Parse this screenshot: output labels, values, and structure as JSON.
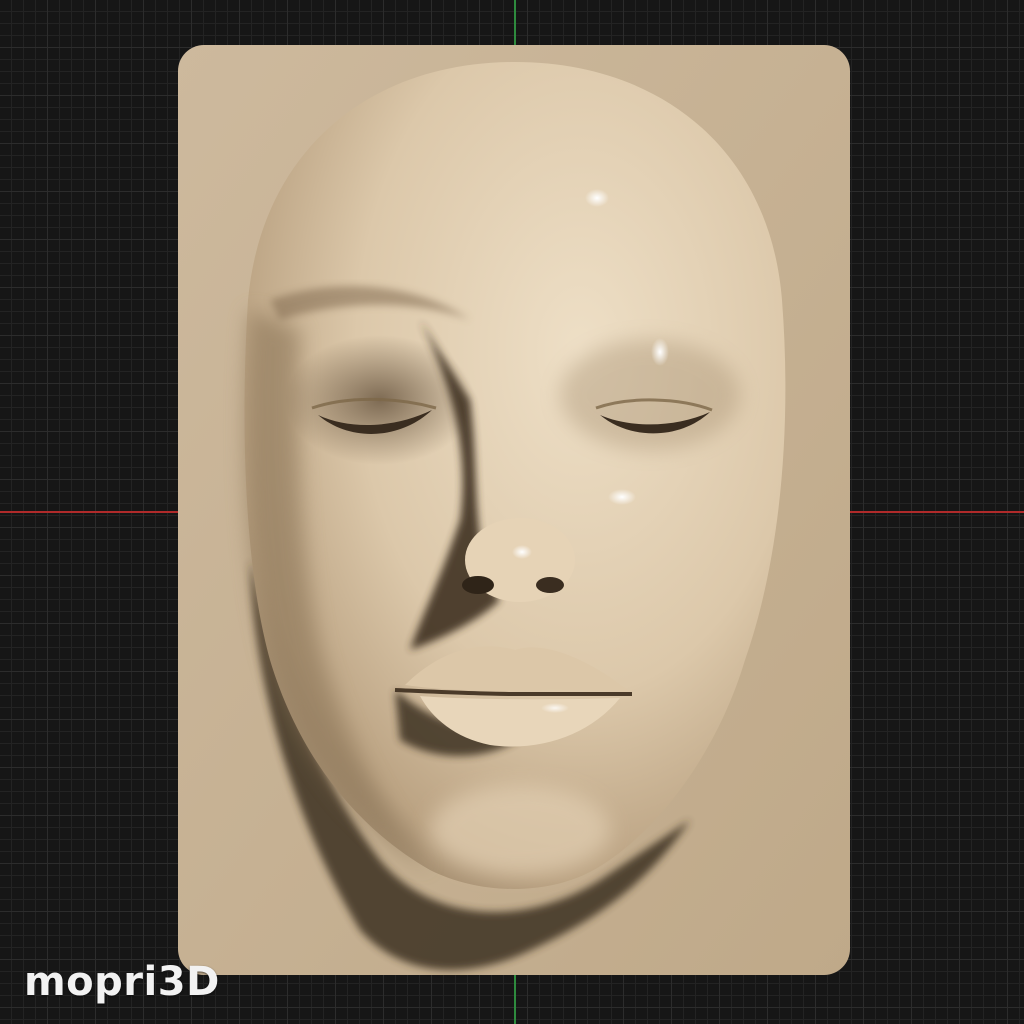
{
  "viewport": {
    "background": "#161616",
    "grid_color": "#2c2c2c",
    "axis_x_color": "#b02a2a",
    "axis_y_color": "#2e8b3e"
  },
  "model": {
    "object": "face-relief-plate",
    "material_color": "#c9b59a"
  },
  "watermark": {
    "text": "mopri3D"
  }
}
